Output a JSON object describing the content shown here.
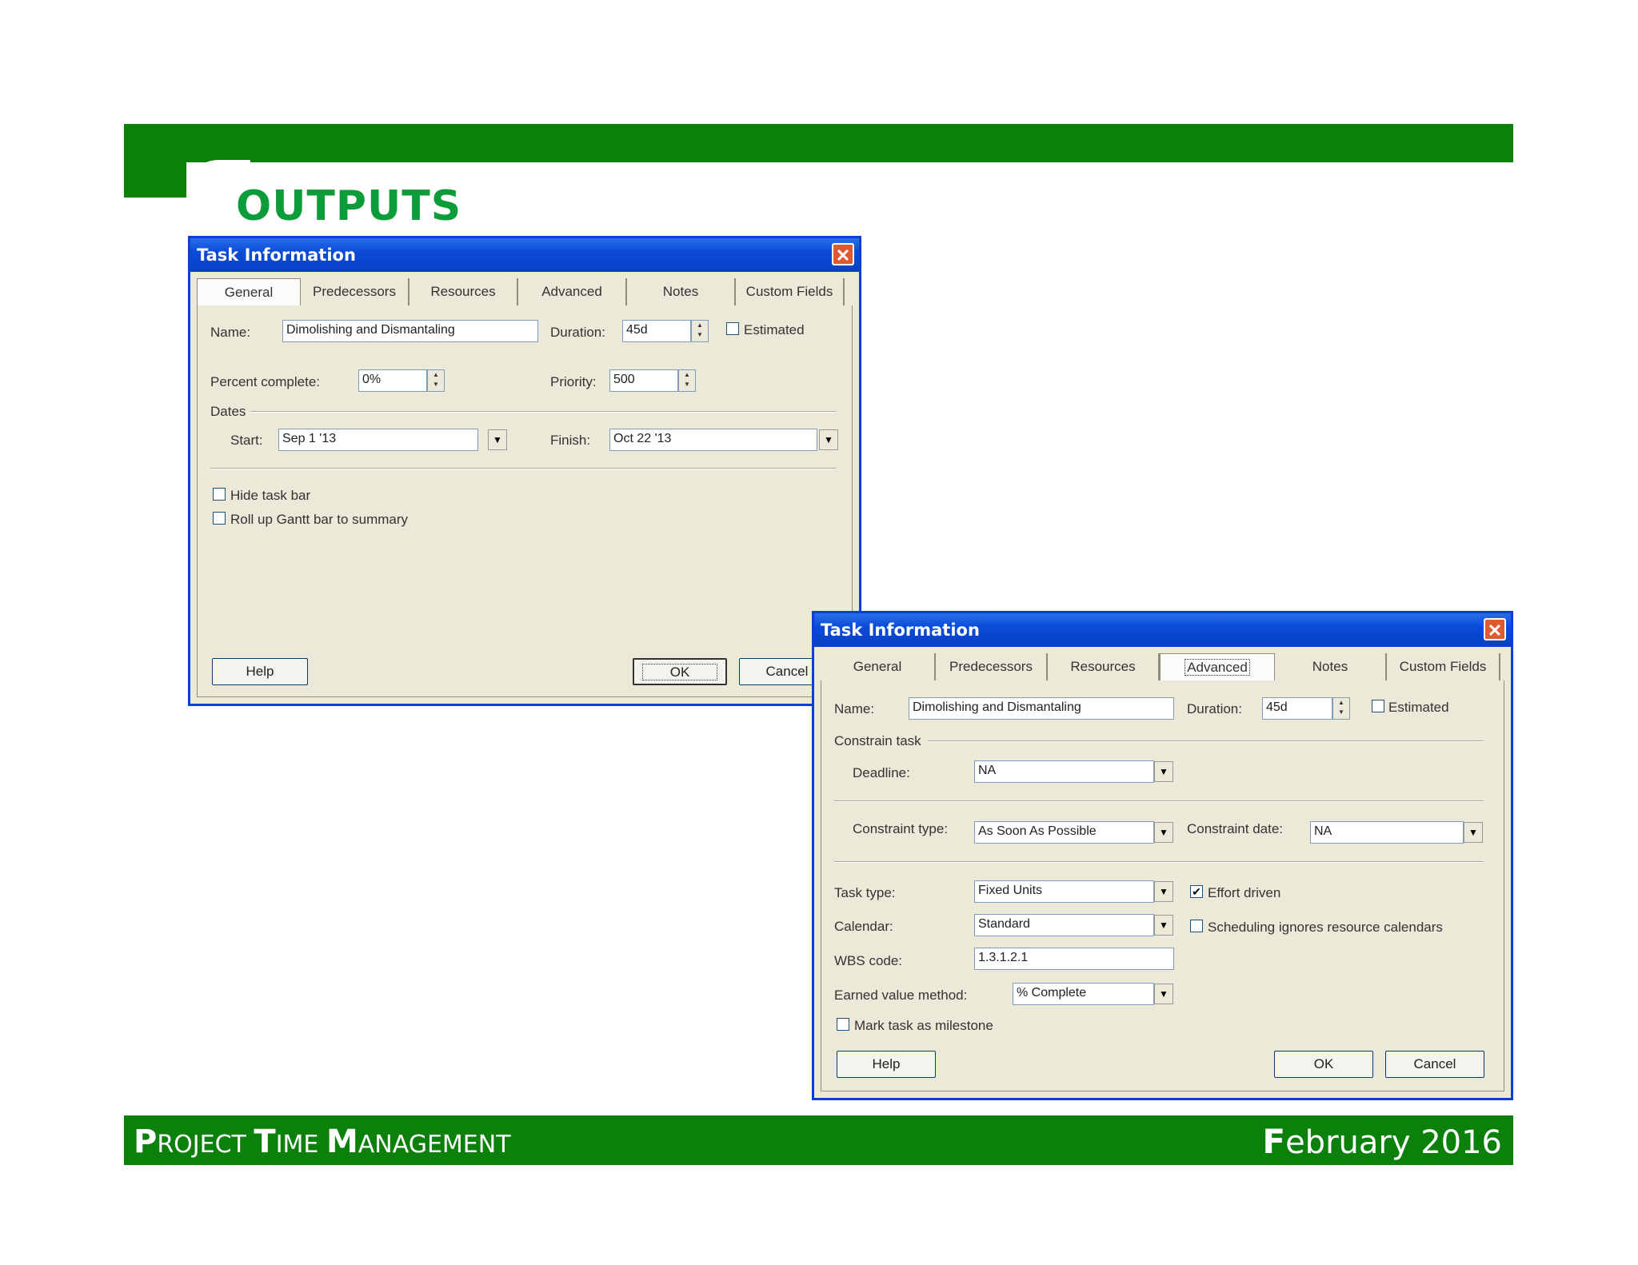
{
  "slide": {
    "title": "OUTPUTS",
    "footer_left": {
      "p1": "P",
      "p2": "ROJECT ",
      "t1": "T",
      "t2": "IME ",
      "m1": "M",
      "m2": "ANAGEMENT"
    },
    "footer_right": {
      "f1": "F",
      "f2": "ebruary 2016"
    },
    "colors": {
      "band": "#0b800b",
      "title": "#0d9c3a"
    }
  },
  "dialog1": {
    "title": "Task Information",
    "tabs": [
      "General",
      "Predecessors",
      "Resources",
      "Advanced",
      "Notes",
      "Custom Fields"
    ],
    "active_tab": "General",
    "name_label": "Name:",
    "name_value": "Dimolishing and Dismantaling",
    "duration_label": "Duration:",
    "duration_value": "45d",
    "estimated_label": "Estimated",
    "percent_label": "Percent complete:",
    "percent_value": "0%",
    "priority_label": "Priority:",
    "priority_value": "500",
    "dates_label": "Dates",
    "start_label": "Start:",
    "start_value": "Sep 1 '13",
    "finish_label": "Finish:",
    "finish_value": "Oct 22 '13",
    "hide_bar_label": "Hide task bar",
    "rollup_label": "Roll up Gantt bar to summary",
    "help_label": "Help",
    "ok_label": "OK",
    "cancel_label": "Cancel"
  },
  "dialog2": {
    "title": "Task Information",
    "tabs": [
      "General",
      "Predecessors",
      "Resources",
      "Advanced",
      "Notes",
      "Custom Fields"
    ],
    "active_tab": "Advanced",
    "name_label": "Name:",
    "name_value": "Dimolishing and Dismantaling",
    "duration_label": "Duration:",
    "duration_value": "45d",
    "estimated_label": "Estimated",
    "constrain_label": "Constrain task",
    "deadline_label": "Deadline:",
    "deadline_value": "NA",
    "constraint_type_label": "Constraint type:",
    "constraint_type_value": "As Soon As Possible",
    "constraint_date_label": "Constraint date:",
    "constraint_date_value": "NA",
    "task_type_label": "Task type:",
    "task_type_value": "Fixed Units",
    "effort_label": "Effort driven",
    "effort_checked": true,
    "calendar_label": "Calendar:",
    "calendar_value": "Standard",
    "sched_label": "Scheduling ignores resource calendars",
    "wbs_label": "WBS code:",
    "wbs_value": "1.3.1.2.1",
    "ev_label": "Earned value method:",
    "ev_value": "% Complete",
    "milestone_label": "Mark task as milestone",
    "help_label": "Help",
    "ok_label": "OK",
    "cancel_label": "Cancel"
  }
}
